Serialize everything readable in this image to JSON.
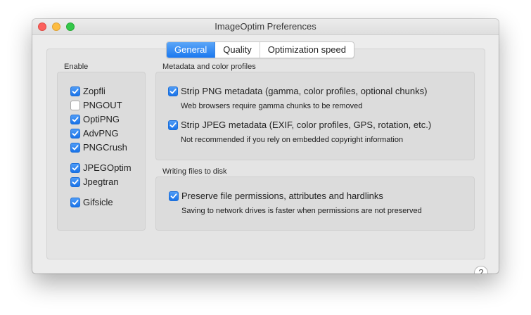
{
  "window": {
    "title": "ImageOptim Preferences"
  },
  "tabs": [
    {
      "label": "General",
      "active": true
    },
    {
      "label": "Quality",
      "active": false
    },
    {
      "label": "Optimization speed",
      "active": false
    }
  ],
  "enable": {
    "label": "Enable",
    "tools": [
      {
        "label": "Zopfli",
        "checked": true
      },
      {
        "label": "PNGOUT",
        "checked": false
      },
      {
        "label": "OptiPNG",
        "checked": true
      },
      {
        "label": "AdvPNG",
        "checked": true
      },
      {
        "label": "PNGCrush",
        "checked": true
      },
      {
        "label": "JPEGOptim",
        "checked": true
      },
      {
        "label": "Jpegtran",
        "checked": true
      },
      {
        "label": "Gifsicle",
        "checked": true
      }
    ]
  },
  "metadata": {
    "label": "Metadata and color profiles",
    "strip_png": {
      "label": "Strip PNG metadata (gamma, color profiles, optional chunks)",
      "checked": true,
      "note": "Web browsers require gamma chunks to be removed"
    },
    "strip_jpeg": {
      "label": "Strip JPEG metadata (EXIF, color profiles, GPS, rotation, etc.)",
      "checked": true,
      "note": "Not recommended if you rely on embedded copyright information"
    }
  },
  "writing": {
    "label": "Writing files to disk",
    "preserve": {
      "label": "Preserve file permissions, attributes and hardlinks",
      "checked": true,
      "note": "Saving to network drives is faster when permissions are not preserved"
    }
  },
  "help": {
    "symbol": "?"
  },
  "colors": {
    "accent": "#1a73e8",
    "window_bg": "#ececec"
  }
}
